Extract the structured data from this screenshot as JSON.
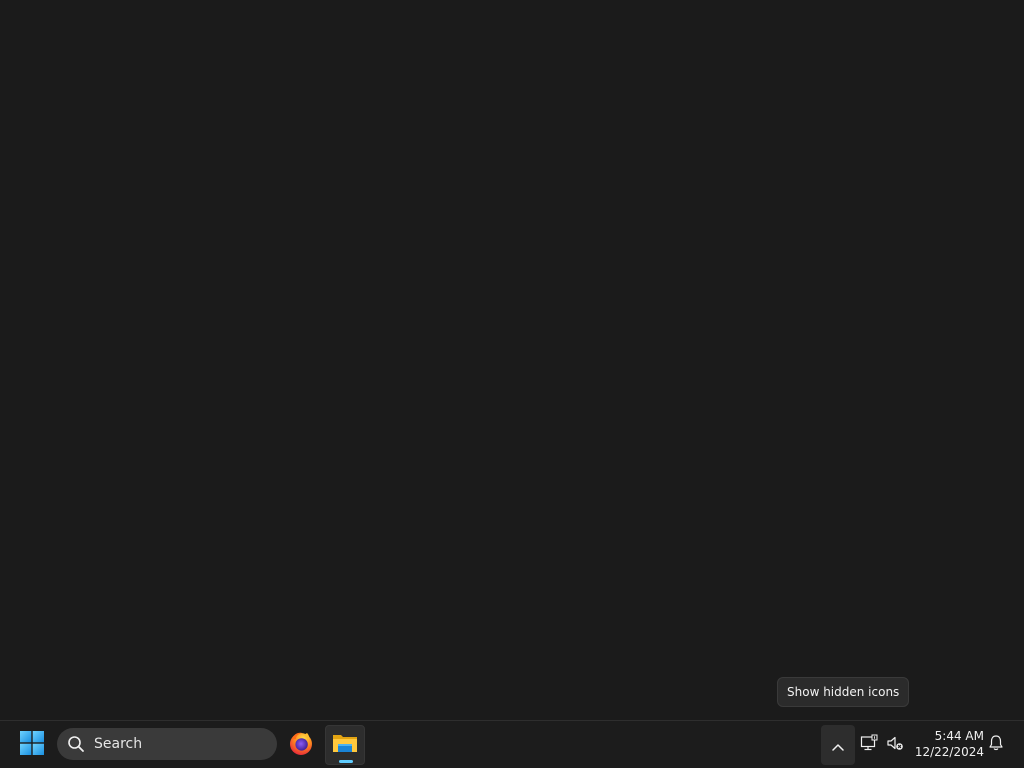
{
  "tooltip": {
    "text": "Show hidden icons"
  },
  "taskbar": {
    "start": {
      "icon": "windows-logo-icon"
    },
    "search": {
      "label": "Search",
      "icon": "search-icon"
    },
    "apps": [
      {
        "name": "Firefox",
        "icon": "firefox-icon",
        "running": false
      },
      {
        "name": "File Explorer",
        "icon": "file-explorer-icon",
        "running": true,
        "active": true
      }
    ],
    "tray": {
      "chevron_icon": "chevron-up-icon",
      "network_icon": "network-icon",
      "volume_icon": "volume-muted-icon",
      "time": "5:44 AM",
      "date": "12/22/2024",
      "notification_icon": "notification-bell-icon"
    }
  },
  "colors": {
    "desktop": "#1b1b1b",
    "taskbar": "#1c1c1c",
    "accent": "#60cdff",
    "windows_logo": "#4cc2ff"
  }
}
